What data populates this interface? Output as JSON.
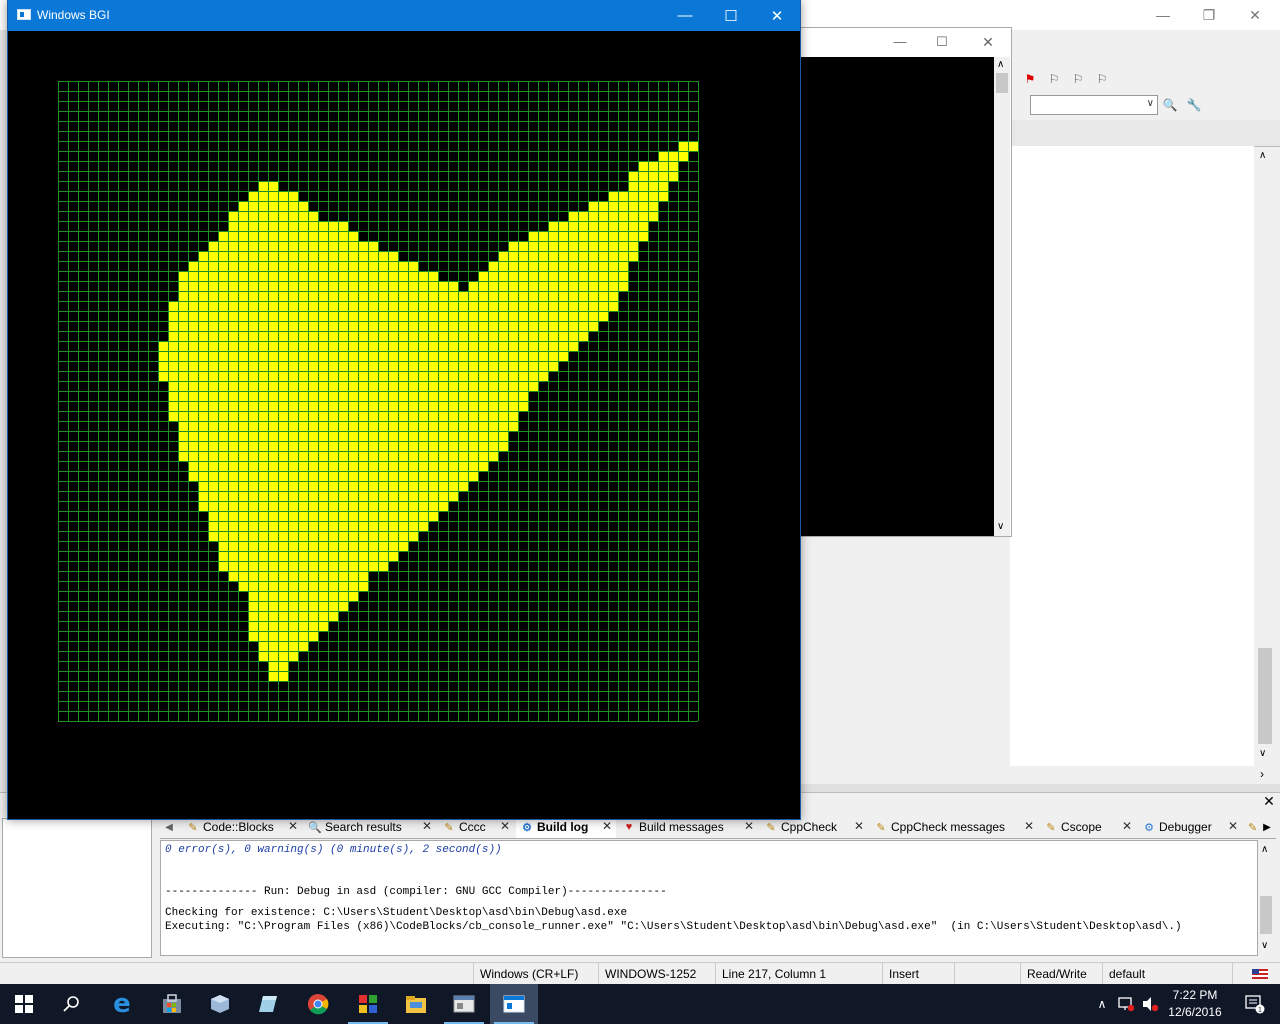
{
  "bgi_window": {
    "title": "Windows BGI"
  },
  "grid": {
    "cols": 64,
    "rows": 64,
    "grid_color": "#1f8f1f",
    "fill_color": "#ffff00",
    "filled_rows": [
      {
        "row": 6,
        "ranges": [
          [
            62,
            63
          ]
        ]
      },
      {
        "row": 7,
        "ranges": [
          [
            60,
            62
          ]
        ]
      },
      {
        "row": 8,
        "ranges": [
          [
            58,
            61
          ]
        ]
      },
      {
        "row": 9,
        "ranges": [
          [
            57,
            61
          ]
        ]
      },
      {
        "row": 10,
        "ranges": [
          [
            20,
            21
          ],
          [
            57,
            60
          ]
        ]
      },
      {
        "row": 11,
        "ranges": [
          [
            19,
            23
          ],
          [
            55,
            60
          ]
        ]
      },
      {
        "row": 12,
        "ranges": [
          [
            18,
            24
          ],
          [
            53,
            59
          ]
        ]
      },
      {
        "row": 13,
        "ranges": [
          [
            17,
            25
          ],
          [
            51,
            59
          ]
        ]
      },
      {
        "row": 14,
        "ranges": [
          [
            17,
            28
          ],
          [
            49,
            58
          ]
        ]
      },
      {
        "row": 15,
        "ranges": [
          [
            16,
            29
          ],
          [
            47,
            58
          ]
        ]
      },
      {
        "row": 16,
        "ranges": [
          [
            15,
            31
          ],
          [
            45,
            57
          ]
        ]
      },
      {
        "row": 17,
        "ranges": [
          [
            14,
            33
          ],
          [
            44,
            57
          ]
        ]
      },
      {
        "row": 18,
        "ranges": [
          [
            13,
            35
          ],
          [
            43,
            56
          ]
        ]
      },
      {
        "row": 19,
        "ranges": [
          [
            12,
            37
          ],
          [
            42,
            56
          ]
        ]
      },
      {
        "row": 20,
        "ranges": [
          [
            12,
            39
          ],
          [
            41,
            56
          ]
        ]
      },
      {
        "row": 21,
        "ranges": [
          [
            12,
            55
          ]
        ]
      },
      {
        "row": 22,
        "ranges": [
          [
            11,
            55
          ]
        ]
      },
      {
        "row": 23,
        "ranges": [
          [
            11,
            54
          ]
        ]
      },
      {
        "row": 24,
        "ranges": [
          [
            11,
            53
          ]
        ]
      },
      {
        "row": 25,
        "ranges": [
          [
            11,
            52
          ]
        ]
      },
      {
        "row": 26,
        "ranges": [
          [
            10,
            51
          ]
        ]
      },
      {
        "row": 27,
        "ranges": [
          [
            10,
            50
          ]
        ]
      },
      {
        "row": 28,
        "ranges": [
          [
            10,
            49
          ]
        ]
      },
      {
        "row": 29,
        "ranges": [
          [
            10,
            48
          ]
        ]
      },
      {
        "row": 30,
        "ranges": [
          [
            11,
            47
          ]
        ]
      },
      {
        "row": 31,
        "ranges": [
          [
            11,
            46
          ]
        ]
      },
      {
        "row": 32,
        "ranges": [
          [
            11,
            46
          ]
        ]
      },
      {
        "row": 33,
        "ranges": [
          [
            11,
            45
          ]
        ]
      },
      {
        "row": 34,
        "ranges": [
          [
            12,
            45
          ]
        ]
      },
      {
        "row": 35,
        "ranges": [
          [
            12,
            44
          ]
        ]
      },
      {
        "row": 36,
        "ranges": [
          [
            12,
            44
          ]
        ]
      },
      {
        "row": 37,
        "ranges": [
          [
            12,
            43
          ]
        ]
      },
      {
        "row": 38,
        "ranges": [
          [
            13,
            42
          ]
        ]
      },
      {
        "row": 39,
        "ranges": [
          [
            13,
            41
          ]
        ]
      },
      {
        "row": 40,
        "ranges": [
          [
            14,
            40
          ]
        ]
      },
      {
        "row": 41,
        "ranges": [
          [
            14,
            39
          ]
        ]
      },
      {
        "row": 42,
        "ranges": [
          [
            14,
            38
          ]
        ]
      },
      {
        "row": 43,
        "ranges": [
          [
            15,
            37
          ]
        ]
      },
      {
        "row": 44,
        "ranges": [
          [
            15,
            36
          ]
        ]
      },
      {
        "row": 45,
        "ranges": [
          [
            15,
            35
          ]
        ]
      },
      {
        "row": 46,
        "ranges": [
          [
            16,
            34
          ]
        ]
      },
      {
        "row": 47,
        "ranges": [
          [
            16,
            33
          ]
        ]
      },
      {
        "row": 48,
        "ranges": [
          [
            16,
            32
          ]
        ]
      },
      {
        "row": 49,
        "ranges": [
          [
            17,
            30
          ]
        ]
      },
      {
        "row": 50,
        "ranges": [
          [
            18,
            30
          ]
        ]
      },
      {
        "row": 51,
        "ranges": [
          [
            19,
            29
          ]
        ]
      },
      {
        "row": 52,
        "ranges": [
          [
            19,
            28
          ]
        ]
      },
      {
        "row": 53,
        "ranges": [
          [
            19,
            27
          ]
        ]
      },
      {
        "row": 54,
        "ranges": [
          [
            19,
            26
          ]
        ]
      },
      {
        "row": 55,
        "ranges": [
          [
            19,
            25
          ]
        ]
      },
      {
        "row": 56,
        "ranges": [
          [
            20,
            24
          ]
        ]
      },
      {
        "row": 57,
        "ranges": [
          [
            20,
            23
          ]
        ]
      },
      {
        "row": 58,
        "ranges": [
          [
            21,
            22
          ]
        ]
      },
      {
        "row": 59,
        "ranges": [
          [
            21,
            22
          ]
        ]
      }
    ]
  },
  "logs_tabs": [
    {
      "label": "Code::Blocks",
      "icon": "document-icon",
      "active": false
    },
    {
      "label": "Search results",
      "icon": "search-icon",
      "active": false
    },
    {
      "label": "Cccc",
      "icon": "document-icon",
      "active": false
    },
    {
      "label": "Build log",
      "icon": "gear-icon",
      "active": true
    },
    {
      "label": "Build messages",
      "icon": "pin-icon",
      "active": false
    },
    {
      "label": "CppCheck",
      "icon": "document-icon",
      "active": false
    },
    {
      "label": "CppCheck messages",
      "icon": "document-icon",
      "active": false
    },
    {
      "label": "Cscope",
      "icon": "document-icon",
      "active": false
    },
    {
      "label": "Debugger",
      "icon": "gear-icon",
      "active": false
    }
  ],
  "build_log": {
    "line1": "0 error(s), 0 warning(s) (0 minute(s), 2 second(s))",
    "line2": "-------------- Run: Debug in asd (compiler: GNU GCC Compiler)---------------",
    "line3": "Checking for existence: C:\\Users\\Student\\Desktop\\asd\\bin\\Debug\\asd.exe",
    "line4": "Executing: \"C:\\Program Files (x86)\\CodeBlocks/cb_console_runner.exe\" \"C:\\Users\\Student\\Desktop\\asd\\bin\\Debug\\asd.exe\"  (in C:\\Users\\Student\\Desktop\\asd\\.)"
  },
  "statusbar": {
    "line_endings": "Windows (CR+LF)",
    "encoding": "WINDOWS-1252",
    "position": "Line 217, Column 1",
    "mode": "Insert",
    "access": "Read/Write",
    "profile": "default"
  },
  "taskbar": {
    "icons": [
      "windows-start-icon",
      "search-icon",
      "edge-icon",
      "store-icon",
      "virtualbox-icon",
      "notepad-icon",
      "chrome-icon",
      "codeblocks-icon",
      "file-explorer-icon",
      "window-icon",
      "bgi-window-icon"
    ],
    "time": "7:22 PM",
    "date": "12/6/2016"
  },
  "colors": {
    "taskbar": "#101828",
    "titlebar_active": "#0b78d7",
    "accent": "#76b9ed"
  }
}
